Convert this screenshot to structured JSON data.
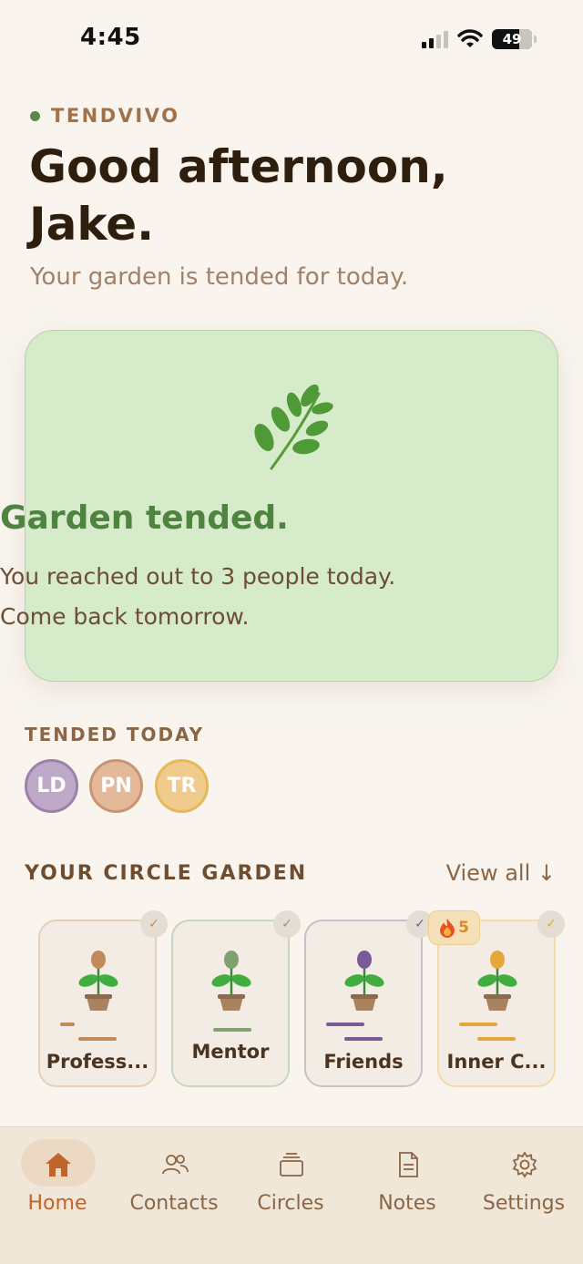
{
  "status_bar": {
    "time": "4:45",
    "battery": "49"
  },
  "header": {
    "brand": "TENDVIVO",
    "greeting_line1": "Good afternoon,",
    "greeting_line2": "Jake.",
    "subtitle": "Your garden is tended for today."
  },
  "hero": {
    "icon": "herb-icon",
    "title": "Garden tended.",
    "line1": "You reached out to 3 people today.",
    "line2": "Come back tomorrow."
  },
  "tended_today": {
    "label": "TENDED TODAY",
    "avatars": [
      {
        "initials": "LD",
        "color": "#bfa9c9",
        "border": "#9c82ab"
      },
      {
        "initials": "PN",
        "color": "#e3b99a",
        "border": "#c99672"
      },
      {
        "initials": "TR",
        "color": "#f0cc8c",
        "border": "#e5b85a"
      }
    ]
  },
  "circle_garden": {
    "label": "YOUR CIRCLE GARDEN",
    "view_all": "View all ↓",
    "circles": [
      {
        "name": "Profess...",
        "accent": "#c08a5a",
        "border": "#e6cfb5",
        "checked": true
      },
      {
        "name": "Mentor",
        "accent": "#7fa06f",
        "border": "#c8d6bd",
        "checked": true
      },
      {
        "name": "Friends",
        "accent": "#7a5a96",
        "border": "#c8c2c8",
        "checked": true
      },
      {
        "name": "Inner C...",
        "accent": "#e5a73a",
        "border": "#f2dba6",
        "checked": true,
        "streak": "5"
      }
    ]
  },
  "nav": {
    "items": [
      {
        "label": "Home",
        "icon": "home-icon",
        "active": true
      },
      {
        "label": "Contacts",
        "icon": "contacts-icon",
        "active": false
      },
      {
        "label": "Circles",
        "icon": "circles-icon",
        "active": false
      },
      {
        "label": "Notes",
        "icon": "notes-icon",
        "active": false
      },
      {
        "label": "Settings",
        "icon": "gear-icon",
        "active": false
      }
    ]
  }
}
